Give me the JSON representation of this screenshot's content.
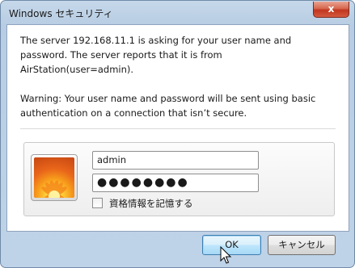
{
  "window": {
    "title": "Windows セキュリティ",
    "close_label": "x"
  },
  "message": {
    "line1": "The server 192.168.11.1 is asking for your user name and",
    "line2": "password. The server reports that it is from",
    "line3": "AirStation(user=admin).",
    "warning1": "Warning: Your user name and password will be sent using basic",
    "warning2": "authentication on a connection that isn’t secure."
  },
  "credentials": {
    "username": "admin",
    "password_mask": "●●●●●●●●",
    "remember_label": "資格情報を記憶する",
    "remember_checked": false
  },
  "buttons": {
    "ok": "OK",
    "cancel": "キャンセル"
  },
  "colors": {
    "frame": "#bfd3e8",
    "close_button": "#c94a32",
    "ok_button_border": "#3c7fb1"
  }
}
